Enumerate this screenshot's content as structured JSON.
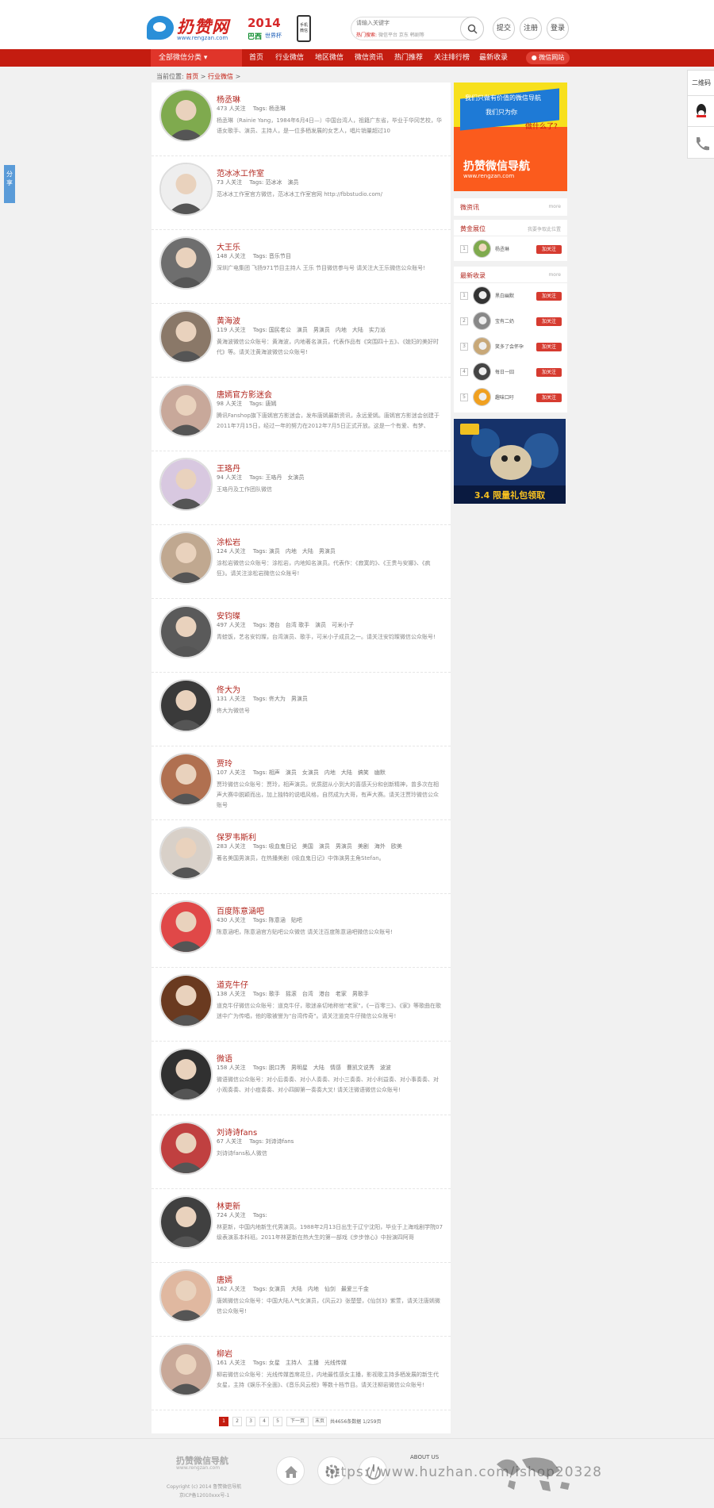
{
  "header": {
    "logo_name": "扔赞网",
    "logo_url": "www.rengzan.com",
    "cup_year": "2014",
    "cup_place": "巴西",
    "cup_label": "世界杯",
    "phone_label": "手机微信",
    "search_placeholder": "请输入关键字",
    "hot_label": "热门搜索:",
    "hot_terms": [
      "微信平台",
      "京东",
      "韩剧等"
    ],
    "buttons": [
      "提交",
      "注册",
      "登录"
    ]
  },
  "nav": {
    "category": "全部微信分类",
    "items": [
      "首页",
      "行业微信",
      "地区微信",
      "微信资讯",
      "热门推荐",
      "关注排行榜",
      "最新收录"
    ],
    "wechat_site": "微信网站"
  },
  "breadcrumb": {
    "label": "当前位置:",
    "home": "首页",
    "sep1": ">",
    "section": "行业微信",
    "sep2": ">"
  },
  "list": [
    {
      "name": "杨丞琳",
      "follows": "473 人关注",
      "tags": "Tags: 杨丞琳",
      "desc": "杨丞琳（Rainie Yang，1984年6月4日—）中国台湾人，祖籍广东省，毕业于华冈艺校，华语女歌手、演员、主持人，是一位多栖发展的女艺人，唱片销量超过10",
      "color": "#7faa4e"
    },
    {
      "name": "范冰冰工作室",
      "follows": "73 人关注",
      "tags": "Tags: 范冰冰　演员",
      "desc": "范冰冰工作室官方微信，范冰冰工作室官网 http://fbbstudio.com/",
      "color": "#eeeeee"
    },
    {
      "name": "大王乐",
      "follows": "148 人关注",
      "tags": "Tags: 音乐节目",
      "desc": "深圳广电集团 飞扬971节目主持人 王乐 节目微信参与号 请关注大王乐微信公众账号!",
      "color": "#6e6e6e"
    },
    {
      "name": "黄海波",
      "follows": "119 人关注",
      "tags": "Tags: 国民老公　演员　男演员　内地　大陆　实力派",
      "desc": "黄海波微信公众账号：黄海波，内地著名演员，代表作品有《突围四十五》、《媳妇的美好时代》等。请关注黄海波微信公众账号!",
      "color": "#8a7868"
    },
    {
      "name": "唐嫣官方影迷会",
      "follows": "98 人关注",
      "tags": "Tags: 唐嫣",
      "desc": "腾讯Fanshop旗下唐嫣官方影迷会，发布唐嫣最新资讯，永远爱嫣。唐嫣官方影迷会创建于2011年7月15日，经过一年的努力在2012年7月5日正式开放。这是一个有爱、有梦、",
      "color": "#c8a89a"
    },
    {
      "name": "王珞丹",
      "follows": "94 人关注",
      "tags": "Tags: 王珞丹　女演员",
      "desc": "王珞丹及工作团队微信",
      "color": "#d8c8e0"
    },
    {
      "name": "涂松岩",
      "follows": "124 人关注",
      "tags": "Tags: 演员　内地　大陆　男演员",
      "desc": "涂松岩微信公众账号：涂松岩，内地知名演员。代表作：《寂寞的》、《王贵与安娜》、《疯狂》。请关注涂松岩微信公众账号!",
      "color": "#c0a890"
    },
    {
      "name": "安钧璨",
      "follows": "497 人关注",
      "tags": "Tags: 港台　台湾 歌手　演员　可米小子",
      "desc": "青蛙饭，艺名安钧璨，台湾演员、歌手，可米小子成员之一。请关注安钧璨微信公众账号!",
      "color": "#5a5a5a"
    },
    {
      "name": "佟大为",
      "follows": "131 人关注",
      "tags": "Tags: 佟大为　男演员",
      "desc": "佟大为微信号",
      "color": "#3a3a3a"
    },
    {
      "name": "贾玲",
      "follows": "107 人关注",
      "tags": "Tags: 相声　演员　女演员　内地　大陆　搞笑　幽默",
      "desc": "贾玲微信公众账号：贾玲，相声演员。优质甜从小到大的喜感天分和创新精神，曾多次在相声大赛中脱颖而出，加上独特的说唱风格，自然成为大哥，有声大赛。请关注贾玲微信公众账号",
      "color": "#b07050"
    },
    {
      "name": "保罗韦斯利",
      "follows": "283 人关注",
      "tags": "Tags: 吸血鬼日记　美国　演员　男演员　美剧　海外　欧美",
      "desc": "著名美国男演员，在热播美剧《吸血鬼日记》中饰演男主角Stefan。",
      "color": "#d8d0c8"
    },
    {
      "name": "百度陈意涵吧",
      "follows": "430 人关注",
      "tags": "Tags: 陈意涵　贴吧",
      "desc": "陈意涵吧，陈意涵官方贴吧公众微信 请关注百度陈意涵吧微信公众账号!",
      "color": "#e04848"
    },
    {
      "name": "道克牛仔",
      "follows": "138 人关注",
      "tags": "Tags: 歌手　摇滚　台湾　港台　老家　男歌手",
      "desc": "道克牛仔微信公众账号：道克牛仔，歌迷亲切地称他\"老家\"，《一百零三》、《家》等歌曲在歌迷中广为传唱，他的歌被誉为\"台湾传奇\"。请关注道克牛仔微信公众账号!",
      "color": "#6a3a20"
    },
    {
      "name": "微语",
      "follows": "158 人关注",
      "tags": "Tags: 脱口秀　男明星　大陆　情感　曹凯文说秀　波波",
      "desc": "微语微信公众账号：对小后奏奏、对小人奏奏、对小三奏奏、对小利益奏、对小事奏奏、对小观奏奏、对小痘奏奏、对小四脚第一奏奏大叉! 请关注微语微信公众账号!",
      "color": "#303030"
    },
    {
      "name": "刘诗诗fans",
      "follows": "67 人关注",
      "tags": "Tags: 刘诗诗fans",
      "desc": "刘诗诗fans私人微信",
      "color": "#c04040"
    },
    {
      "name": "林更新",
      "follows": "724 人关注",
      "tags": "Tags:",
      "desc": "林更新，中国内地新生代男演员。1988年2月13日出生于辽宁沈阳，毕业于上海戏剧学院07级表演系本科班。2011年林更新在热大生的第一部戏《步步惊心》中扮演四阿哥",
      "color": "#404040"
    },
    {
      "name": "唐嫣",
      "follows": "162 人关注",
      "tags": "Tags: 女演员　大陆　内地　仙剑　最爱三千金",
      "desc": "唐嫣微信公众账号：中国大陆人气女演员，《风云2》张楚楚，《仙剑3》紫萱，请关注唐嫣微信公众账号!",
      "color": "#e0b8a0"
    },
    {
      "name": "柳岩",
      "follows": "161 人关注",
      "tags": "Tags: 女星　主持人　主播　光线传媒",
      "desc": "柳岩微信公众账号：光线传媒首席花旦，内地最性感女主播，影视歌主持多栖发展的新生代女星，主持《娱乐不全面》、《音乐风云榜》等数十档节目。请关注柳岩微信公众账号!",
      "color": "#c8a898"
    }
  ],
  "pager": {
    "pages": [
      "1",
      "2",
      "3",
      "4",
      "5"
    ],
    "next": "下一页",
    "last": "末页",
    "info": "共4656条数据 1/259页"
  },
  "sidebar": {
    "ad_lines": [
      "我们只做有价值的微信导航",
      "我们只为你",
      "做什么了?"
    ],
    "ad_title": "扔赞微信导航",
    "ad_url": "www.rengzan.com",
    "news_title": "微资讯",
    "news_more": "more",
    "gold_title": "黄金展位",
    "gold_more": "我要争取此位置",
    "gold": [
      {
        "rank": "1",
        "name": "杨丞琳",
        "btn": "加关注",
        "color": "#7faa4e"
      }
    ],
    "latest_title": "最新收录",
    "latest_more": "more",
    "latest": [
      {
        "rank": "1",
        "name": "黑白幽默",
        "btn": "加关注",
        "color": "#333333"
      },
      {
        "rank": "2",
        "name": "宝有二奶",
        "btn": "加关注",
        "color": "#888888"
      },
      {
        "rank": "3",
        "name": "笑多了会怀孕",
        "btn": "加关注",
        "color": "#c8a878"
      },
      {
        "rank": "4",
        "name": "每日一囧",
        "btn": "加关注",
        "color": "#444444"
      },
      {
        "rank": "5",
        "name": "趣味口吁",
        "btn": "加关注",
        "color": "#f0a020"
      }
    ],
    "game_text": "3.4 限量礼包领取"
  },
  "right_tools": {
    "qr": "二维码"
  },
  "share": "分享",
  "footer": {
    "logo": "扔赞微信导航",
    "url": "www.rengzan.com",
    "copyright": "Copyright (c) 2014 鲁赞微信导航",
    "icp": "京ICP备12010xxx号-1",
    "about": "ABOUT US",
    "watermark": "https://www.huzhan.com/ishop20328"
  }
}
